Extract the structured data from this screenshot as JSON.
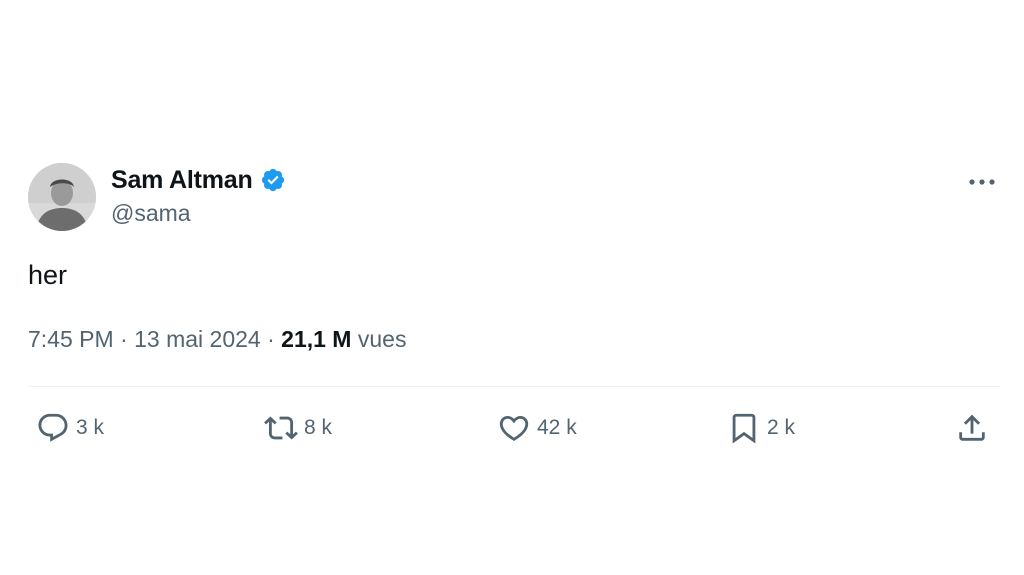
{
  "author": {
    "display_name": "Sam Altman",
    "handle": "@sama",
    "verified": true,
    "verified_color": "#1d9bf0"
  },
  "tweet": {
    "text": "her",
    "time": "7:45 PM",
    "separator": "·",
    "date": "13 mai 2024",
    "views_count": "21,1 M",
    "views_label": "vues"
  },
  "actions": {
    "replies": "3 k",
    "retweets": "8 k",
    "likes": "42 k",
    "bookmarks": "2 k"
  },
  "icons": {
    "more": "more-horizontal-icon",
    "reply": "reply-icon",
    "retweet": "retweet-icon",
    "like": "heart-icon",
    "bookmark": "bookmark-icon",
    "share": "share-icon"
  },
  "colors": {
    "text_primary": "#0f1419",
    "text_secondary": "#536471",
    "divider": "#eff3f4"
  }
}
